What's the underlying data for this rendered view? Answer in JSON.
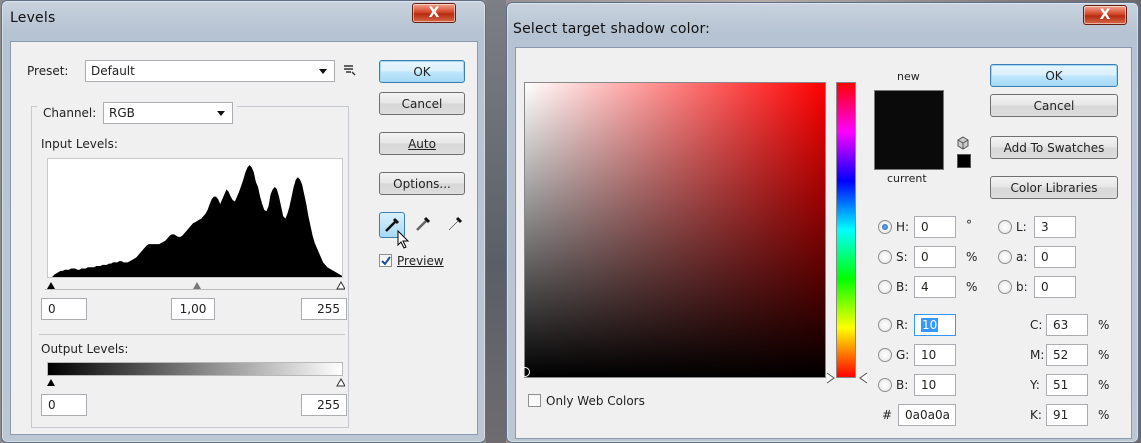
{
  "levels": {
    "title": "Levels",
    "close": "X",
    "preset_label": "Preset:",
    "preset_value": "Default",
    "channel_label": "Channel:",
    "channel_value": "RGB",
    "input_levels_label": "Input Levels:",
    "input_black": "0",
    "input_gamma": "1,00",
    "input_white": "255",
    "output_levels_label": "Output Levels:",
    "output_black": "0",
    "output_white": "255",
    "buttons": {
      "ok": "OK",
      "cancel": "Cancel",
      "auto": "Auto",
      "options": "Options..."
    },
    "preview_label": "Preview",
    "preview_checked": true,
    "histogram": [
      0,
      0,
      0,
      2,
      3,
      4,
      5,
      5,
      6,
      6,
      6,
      7,
      7,
      7,
      6,
      6,
      7,
      7,
      7,
      8,
      8,
      8,
      8,
      9,
      9,
      9,
      10,
      10,
      10,
      11,
      11,
      12,
      12,
      12,
      13,
      13,
      12,
      12,
      12,
      13,
      14,
      15,
      16,
      18,
      20,
      22,
      24,
      26,
      27,
      27,
      27,
      27,
      27,
      27,
      28,
      29,
      30,
      32,
      34,
      35,
      35,
      34,
      33,
      33,
      34,
      36,
      38,
      40,
      42,
      44,
      45,
      46,
      47,
      48,
      50,
      52,
      55,
      60,
      64,
      66,
      66,
      64,
      60,
      64,
      68,
      72,
      70,
      66,
      63,
      62,
      66,
      70,
      75,
      80,
      86,
      90,
      92,
      90,
      86,
      78,
      74,
      66,
      60,
      55,
      54,
      58,
      68,
      72,
      74,
      72,
      66,
      58,
      50,
      48,
      52,
      58,
      66,
      74,
      80,
      82,
      80,
      76,
      68,
      60,
      50,
      42,
      34,
      28,
      24,
      20,
      16,
      12,
      10,
      8,
      7,
      6,
      5,
      4,
      3,
      2,
      1
    ]
  },
  "picker": {
    "title": "Select target shadow color:",
    "close": "X",
    "new_label": "new",
    "current_label": "current",
    "buttons": {
      "ok": "OK",
      "cancel": "Cancel",
      "add_swatches": "Add To Swatches",
      "color_libraries": "Color Libraries"
    },
    "only_web_colors": "Only Web Colors",
    "fields": {
      "h": {
        "label": "H:",
        "value": "0",
        "unit": "°"
      },
      "s": {
        "label": "S:",
        "value": "0",
        "unit": "%"
      },
      "b": {
        "label": "B:",
        "value": "4",
        "unit": "%"
      },
      "r": {
        "label": "R:",
        "value": "10"
      },
      "g": {
        "label": "G:",
        "value": "10"
      },
      "b2": {
        "label": "B:",
        "value": "10"
      },
      "l": {
        "label": "L:",
        "value": "3"
      },
      "a": {
        "label": "a:",
        "value": "0"
      },
      "lab_b": {
        "label": "b:",
        "value": "0"
      },
      "c": {
        "label": "C:",
        "value": "63",
        "unit": "%"
      },
      "m": {
        "label": "M:",
        "value": "52",
        "unit": "%"
      },
      "y": {
        "label": "Y:",
        "value": "51",
        "unit": "%"
      },
      "k": {
        "label": "K:",
        "value": "91",
        "unit": "%"
      },
      "hex_label": "#",
      "hex_value": "0a0a0a"
    },
    "swatch_color": "#0a0a0a",
    "hue_color": "#ff0000"
  }
}
